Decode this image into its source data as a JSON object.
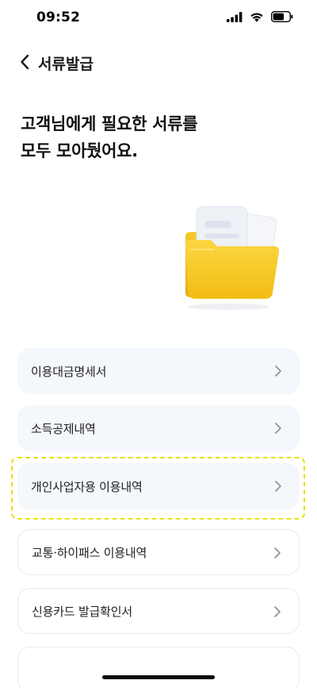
{
  "status_bar": {
    "time": "09:52",
    "icons": [
      "cellular-signal-icon",
      "wifi-icon",
      "battery-icon"
    ]
  },
  "nav": {
    "back_icon": "chevron-left-icon",
    "title": "서류발급"
  },
  "headline": {
    "line1": "고객님에게 필요한 서류를",
    "line2": "모두 모아뒀어요."
  },
  "illustration": {
    "icon": "document-folder-icon",
    "colors": {
      "folder": "#f5c518",
      "paper": "#eef1f6"
    }
  },
  "documents": [
    {
      "label": "이용대금명세서",
      "style": "filled"
    },
    {
      "label": "소득공제내역",
      "style": "filled"
    },
    {
      "label": "개인사업자용 이용내역",
      "style": "filled",
      "highlighted": true
    },
    {
      "label": "교통·하이패스 이용내역",
      "style": "outlined"
    },
    {
      "label": "신용카드 발급확인서",
      "style": "outlined"
    },
    {
      "label": "",
      "style": "outlined"
    }
  ],
  "colors": {
    "filled_item_bg": "#f4f7fb",
    "outlined_item_border": "#e7eaee",
    "highlight": "#e9e017",
    "chevron": "#8a8f98"
  }
}
